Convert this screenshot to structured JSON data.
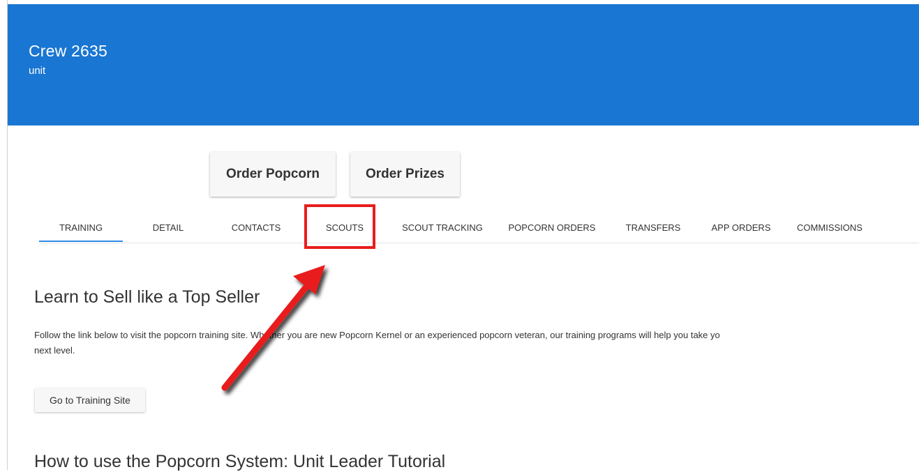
{
  "header": {
    "title": "Crew 2635",
    "subtitle": "unit",
    "color": "#1976d2"
  },
  "actions": {
    "order_popcorn": "Order Popcorn",
    "order_prizes": "Order Prizes"
  },
  "tabs": [
    {
      "label": "TRAINING",
      "active": true
    },
    {
      "label": "DETAIL",
      "active": false
    },
    {
      "label": "CONTACTS",
      "active": false
    },
    {
      "label": "SCOUTS",
      "active": false,
      "highlighted": true
    },
    {
      "label": "SCOUT TRACKING",
      "active": false
    },
    {
      "label": "POPCORN ORDERS",
      "active": false
    },
    {
      "label": "TRANSFERS",
      "active": false
    },
    {
      "label": "APP ORDERS",
      "active": false
    },
    {
      "label": "COMMISSIONS",
      "active": false
    }
  ],
  "training": {
    "title": "Learn to Sell like a Top Seller",
    "description": "Follow the link below to visit the popcorn training site. Whether you are new Popcorn Kernel or an experienced popcorn veteran, our training programs will help you take yo",
    "description_cont": "next level.",
    "button_label": "Go to Training Site"
  },
  "tutorial": {
    "title": "How to use the Popcorn System: Unit Leader Tutorial"
  },
  "annotation": {
    "highlight_color": "#e81d1d",
    "arrow_color": "#e81d1d"
  }
}
